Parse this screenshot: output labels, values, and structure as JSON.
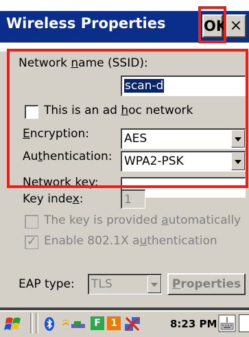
{
  "window": {
    "title": "Wireless Properties",
    "ok_label": "OK",
    "close_label": "×"
  },
  "form": {
    "ssid_label_pre": "Network ",
    "ssid_label_u": "n",
    "ssid_label_post": "ame (SSID):",
    "ssid_value": "scan-d",
    "adhoc_pre": "This is an ad ",
    "adhoc_u": "h",
    "adhoc_post": "oc network",
    "encryption_u": "E",
    "encryption_post": "ncryption:",
    "encryption_value": "AES",
    "auth_pre": "Au",
    "auth_u": "t",
    "auth_post": "hentication:",
    "auth_value": "WPA2-PSK",
    "netkey_pre": "Network ",
    "netkey_u": "k",
    "netkey_post": "ey:",
    "netkey_value": "",
    "keyindex_pre": "Key inde",
    "keyindex_u": "x",
    "keyindex_post": ":",
    "keyindex_value": "1",
    "auto_pre": "The key is provided ",
    "auto_u": "a",
    "auto_post": "utomatically",
    "enable_pre": "Enable 802.1X a",
    "enable_u": "u",
    "enable_post": "thentication",
    "eap_label": "EAP type:",
    "eap_value": "TLS",
    "properties_u": "P",
    "properties_post": "roperties"
  },
  "taskbar": {
    "clock": "8:23 PM",
    "tray_letters": [
      "F",
      "1"
    ]
  },
  "colors": {
    "title_bar": "#0a2e8a",
    "highlight": "#e8211b",
    "dialog_bg": "#d4d0c8"
  }
}
